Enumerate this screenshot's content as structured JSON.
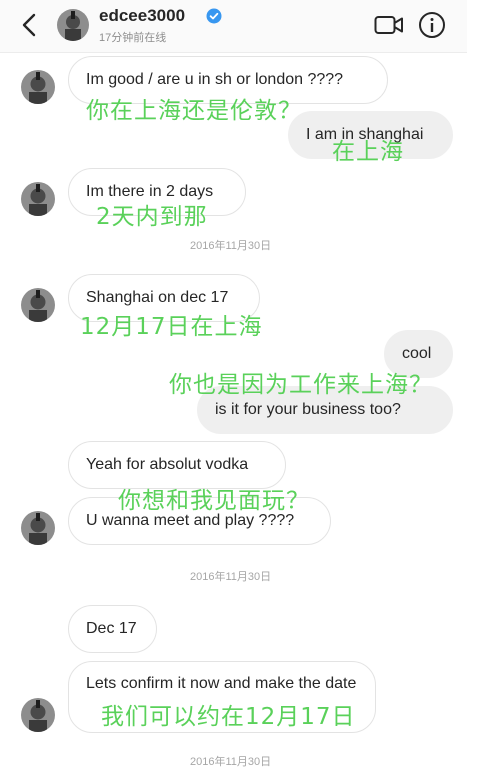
{
  "header": {
    "username": "edcee3000",
    "status": "17分钟前在线",
    "icons": [
      "back-chevron-icon",
      "verified-badge-icon",
      "video-call-icon",
      "info-icon"
    ],
    "accent_color": "#3897f0"
  },
  "messages": [
    {
      "from": "them",
      "text": "Im good / are u in sh or london ????"
    },
    {
      "from": "me",
      "text": "I am in shanghai"
    },
    {
      "from": "them",
      "text": "Im there in 2 days"
    },
    {
      "from": "them",
      "text": "Shanghai on dec 17"
    },
    {
      "from": "me",
      "text": "cool"
    },
    {
      "from": "me",
      "text": "is it for your business too?"
    },
    {
      "from": "them",
      "text": "Yeah for absolut vodka"
    },
    {
      "from": "them",
      "text": "U wanna meet and play ????"
    },
    {
      "from": "them",
      "text": "Dec 17"
    },
    {
      "from": "them",
      "text": "Lets confirm it now and make the date"
    }
  ],
  "dates": [
    "2016年11月30日",
    "2016年11月30日",
    "2016年11月30日"
  ],
  "translations": [
    "你在上海还是伦敦？",
    "在上海",
    "2天内到那",
    "12月17日在上海",
    "你也是因为工作来上海？",
    "你想和我见面玩？",
    "我们可以约在12月17日"
  ],
  "overlay_color": "#5ad15a"
}
